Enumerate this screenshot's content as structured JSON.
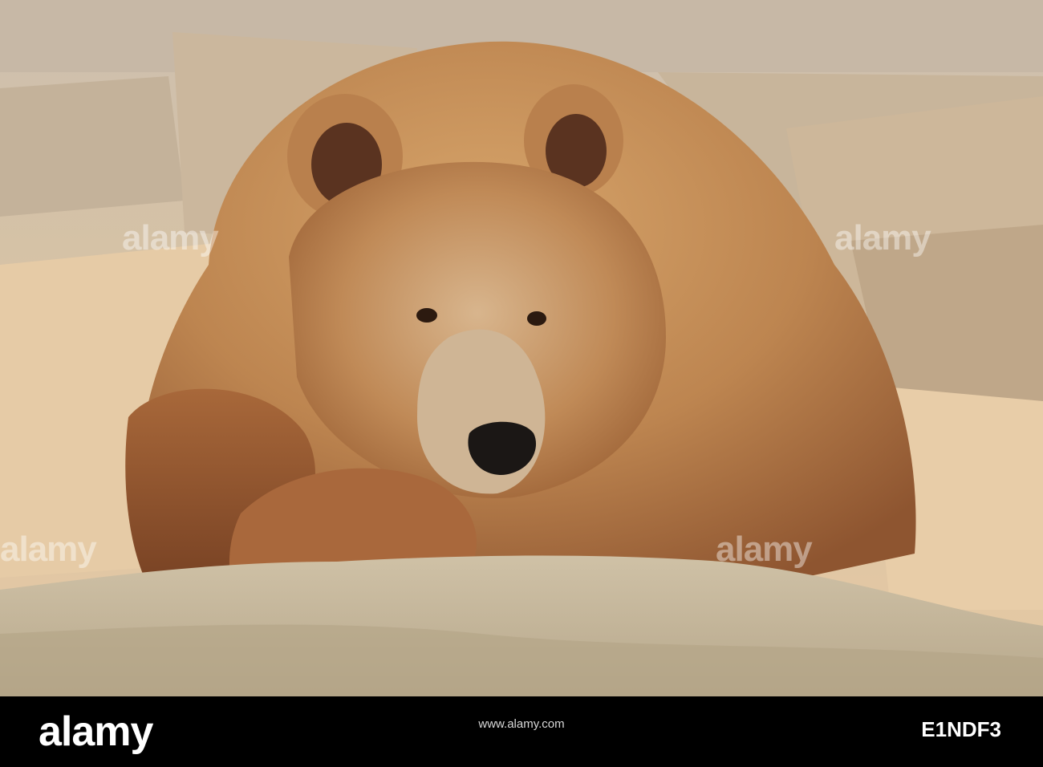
{
  "watermark": {
    "text": "alamy",
    "color": "#ffffff"
  },
  "footer": {
    "brand": "alamy",
    "caption": "www.alamy.com",
    "image_id": "E1NDF3",
    "background": "#000000"
  },
  "scene": {
    "palette": {
      "sand": "#e3c9a6",
      "rock": "#c9b79a",
      "fur_light": "#c79158",
      "fur_dark": "#8a4e2b",
      "nose": "#1b1715"
    }
  }
}
